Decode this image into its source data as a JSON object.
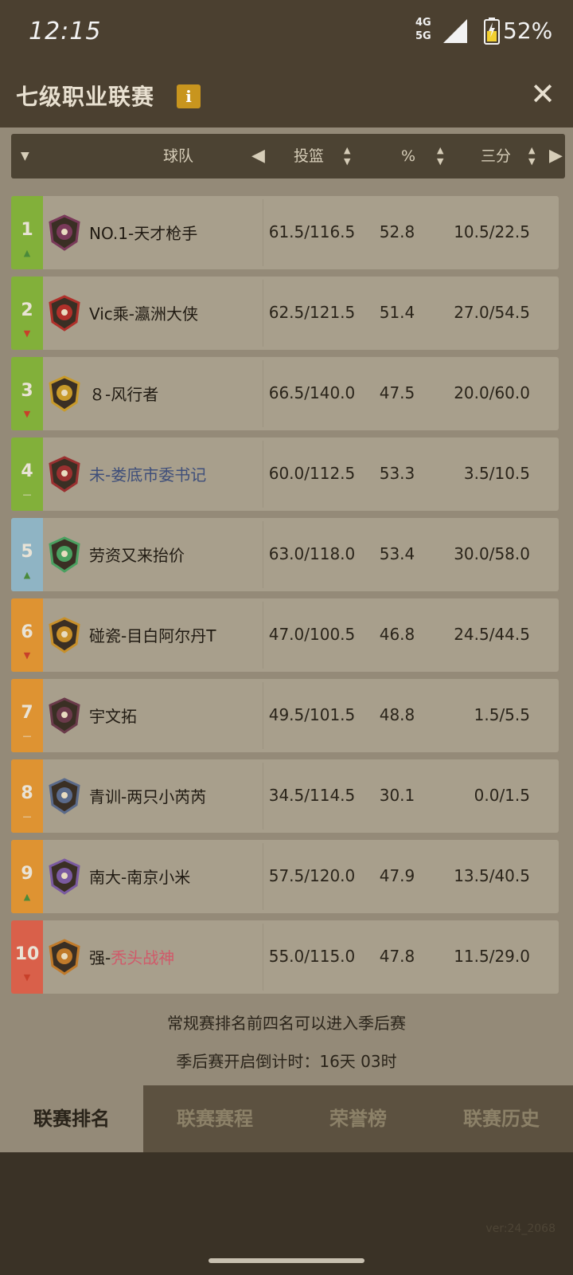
{
  "status_bar": {
    "time": "12:15",
    "network_top": "4G",
    "network_bottom": "5G",
    "battery": "52%"
  },
  "header": {
    "title": "七级职业联赛",
    "info_icon": "i",
    "close_icon": "✕"
  },
  "columns": {
    "team": "球队",
    "fg": "投篮",
    "pct": "%",
    "three": "三分"
  },
  "rows": [
    {
      "rank": "1",
      "trend": "up",
      "trend_symbol": "▲",
      "color": "#82b03a",
      "name": "NO.1-天才枪手",
      "fg": "61.5/116.5",
      "pct": "52.8",
      "tp": "10.5/22.5"
    },
    {
      "rank": "2",
      "trend": "down",
      "trend_symbol": "▼",
      "color": "#82b03a",
      "name": "Vic乘-瀛洲大侠",
      "fg": "62.5/121.5",
      "pct": "51.4",
      "tp": "27.0/54.5"
    },
    {
      "rank": "3",
      "trend": "down",
      "trend_symbol": "▼",
      "color": "#82b03a",
      "name": "８-风行者",
      "fg": "66.5/140.0",
      "pct": "47.5",
      "tp": "20.0/60.0"
    },
    {
      "rank": "4",
      "trend": "same",
      "trend_symbol": "—",
      "color": "#82b03a",
      "name": "未-娄底市委书记",
      "fg": "60.0/112.5",
      "pct": "53.3",
      "tp": "3.5/10.5"
    },
    {
      "rank": "5",
      "trend": "up",
      "trend_symbol": "▲",
      "color": "#8fb4c4",
      "name": "劳资又来抬价",
      "fg": "63.0/118.0",
      "pct": "53.4",
      "tp": "30.0/58.0"
    },
    {
      "rank": "6",
      "trend": "down",
      "trend_symbol": "▼",
      "color": "#de9332",
      "name": "碰瓷-目白阿尔丹T",
      "fg": "47.0/100.5",
      "pct": "46.8",
      "tp": "24.5/44.5"
    },
    {
      "rank": "7",
      "trend": "same",
      "trend_symbol": "—",
      "color": "#de9332",
      "name": "宇文拓",
      "fg": "49.5/101.5",
      "pct": "48.8",
      "tp": "1.5/5.5"
    },
    {
      "rank": "8",
      "trend": "same",
      "trend_symbol": "—",
      "color": "#de9332",
      "name": "青训-两只小芮芮",
      "fg": "34.5/114.5",
      "pct": "30.1",
      "tp": "0.0/1.5"
    },
    {
      "rank": "9",
      "trend": "up",
      "trend_symbol": "▲",
      "color": "#de9332",
      "name": "南大-南京小米",
      "fg": "57.5/120.0",
      "pct": "47.9",
      "tp": "13.5/40.5"
    },
    {
      "rank": "10",
      "trend": "down",
      "trend_symbol": "▼",
      "color": "#d9604a",
      "name_prefix": "强-",
      "name_suffix": "秃头战神",
      "fg": "55.0/115.0",
      "pct": "47.8",
      "tp": "11.5/29.0"
    }
  ],
  "notes": {
    "line1": "常规赛排名前四名可以进入季后赛",
    "line2": "季后赛开启倒计时：16天 03时"
  },
  "tabs": [
    "联赛排名",
    "联赛赛程",
    "荣誉榜",
    "联赛历史"
  ],
  "version": "ver:24_2068"
}
